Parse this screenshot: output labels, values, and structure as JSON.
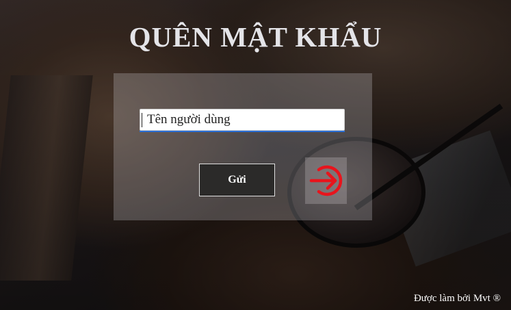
{
  "page": {
    "title": "QUÊN MẬT KHẨU",
    "footer": "Được làm bởi Mvt ®"
  },
  "form": {
    "username_placeholder": "Tên người dùng",
    "username_value": "",
    "submit_label": "Gửi",
    "login_icon": "sign-in-icon"
  },
  "colors": {
    "accent_icon": "#e8141c",
    "title": "#e4e4e8",
    "button_bg": "#2b2a29"
  }
}
